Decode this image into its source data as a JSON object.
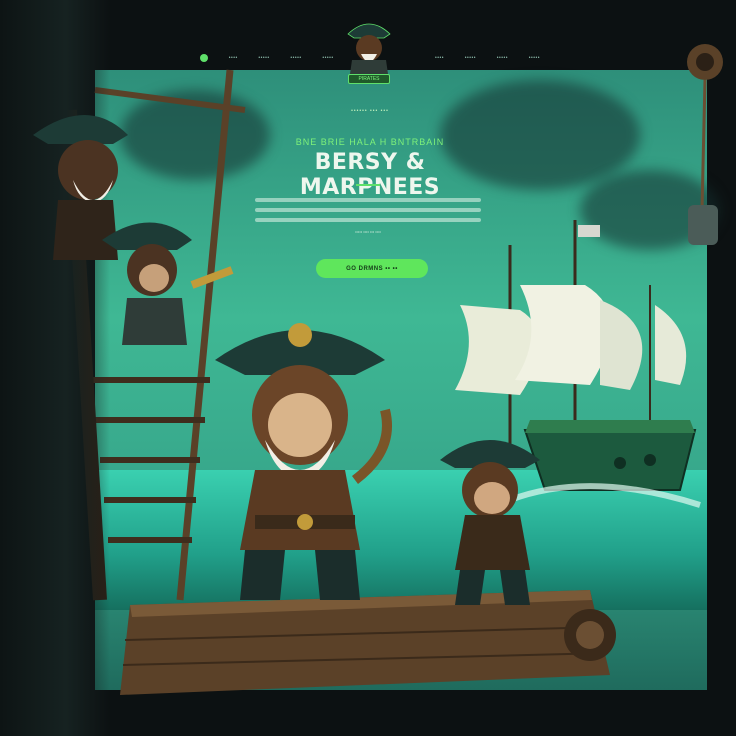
{
  "nav": {
    "items": [
      "••••",
      "•••••",
      "•••••",
      "•••••",
      "••••",
      "•••••",
      "•••••",
      "•••••"
    ],
    "logo_label": "PIRATES"
  },
  "hero": {
    "eyebrow": "•••••• ••• •••",
    "kicker": "BNE BRIE HALA H BNTRBAIN",
    "headline": "BERSY & MARPNEES",
    "subline": "••••• •••• ••• ••••",
    "cta_label": "GO DRMNS  ••  ••"
  },
  "colors": {
    "accent": "#5fe65c",
    "background": "#0c1112",
    "sea": "#3ad0b0",
    "headline": "#eef7ee"
  },
  "icons": [
    "pirate-monkey-logo-icon",
    "nav-dot-icon"
  ]
}
